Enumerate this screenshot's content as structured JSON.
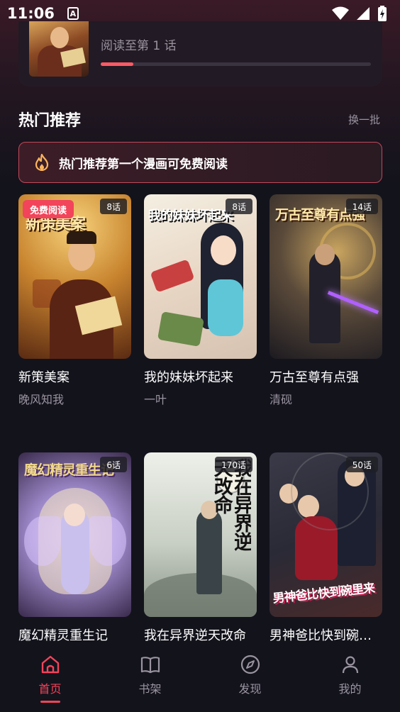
{
  "status_bar": {
    "time": "11:06",
    "indicator": "A"
  },
  "continue_reading": {
    "progress_text": "阅读至第 1 话",
    "progress": 0.12
  },
  "section": {
    "title": "热门推荐",
    "refresh_label": "换一批"
  },
  "banner": {
    "icon": "flame-icon",
    "text": "热门推荐第一个漫画可免费阅读"
  },
  "comics": [
    {
      "title": "新策美案",
      "author": "晚风知我",
      "chapters": "8话",
      "badge": "免费阅读",
      "cover_art": "新策美案"
    },
    {
      "title": "我的妹妹坏起来",
      "author": "一叶",
      "chapters": "8话",
      "cover_art": "我的妹妹坏起来"
    },
    {
      "title": "万古至尊有点强",
      "author": "清砚",
      "chapters": "14话",
      "cover_art": "万古至尊有点强"
    },
    {
      "title": "魔幻精灵重生记",
      "author": "",
      "chapters": "6话",
      "cover_art": "魔幻精灵重生记"
    },
    {
      "title": "我在异界逆天改命",
      "author": "",
      "chapters": "170话",
      "cover_art": "我在异界逆天改命"
    },
    {
      "title": "男神爸比快到碗里来",
      "author": "",
      "chapters": "50话",
      "cover_art": "男神爸比快到碗里来"
    }
  ],
  "nav": [
    {
      "label": "首页",
      "icon": "home-icon",
      "active": true
    },
    {
      "label": "书架",
      "icon": "book-icon",
      "active": false
    },
    {
      "label": "发现",
      "icon": "compass-icon",
      "active": false
    },
    {
      "label": "我的",
      "icon": "user-icon",
      "active": false
    }
  ],
  "colors": {
    "accent": "#f2445a",
    "background": "#13131c",
    "muted": "#9a94a0"
  }
}
